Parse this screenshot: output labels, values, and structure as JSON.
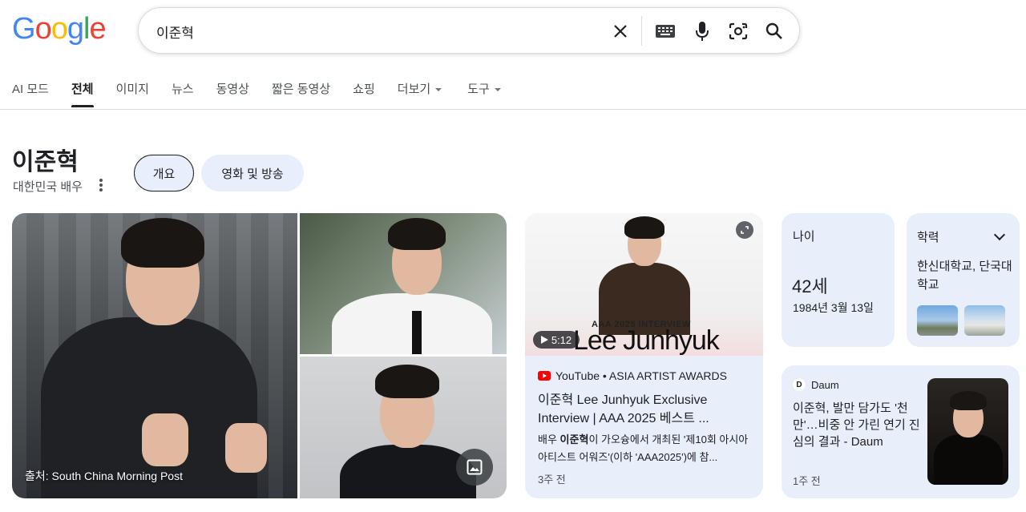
{
  "header": {
    "logo_text": "Google",
    "search": {
      "query": "이준혁"
    }
  },
  "tabs": [
    {
      "label": "AI 모드"
    },
    {
      "label": "전체"
    },
    {
      "label": "이미지"
    },
    {
      "label": "뉴스"
    },
    {
      "label": "동영상"
    },
    {
      "label": "짧은 동영상"
    },
    {
      "label": "쇼핑"
    },
    {
      "label": "더보기"
    },
    {
      "label": "도구"
    }
  ],
  "entity": {
    "title": "이준혁",
    "subtitle": "대한민국 배우",
    "chips": [
      {
        "label": "개요"
      },
      {
        "label": "영화 및 방송"
      }
    ]
  },
  "images": {
    "caption": "출처: South China Morning Post"
  },
  "video": {
    "thumb_tag": "AAA 2025 INTERVIEW",
    "thumb_title": "Lee Junhyuk",
    "duration": "5:12",
    "source": "YouTube • ASIA ARTIST AWARDS",
    "title": "이준혁 Lee Junhyuk Exclusive Interview | AAA 2025 베스트 ...",
    "snippet_pre": "배우 ",
    "snippet_bold": "이준혁",
    "snippet_post": "이 가오슝에서 개최된 '제10회 아시아 아티스트 어워즈'(이하 'AAA2025')에 참...",
    "time": "3주 전"
  },
  "age": {
    "label": "나이",
    "value": "42세",
    "birth": "1984년 3월 13일"
  },
  "education": {
    "label": "학력",
    "value": "한신대학교, 단국대학교"
  },
  "news": {
    "source": "Daum",
    "logo_letter": "D",
    "title": "이준혁, 발만 담가도 '천만'…비중 안 가린 연기 진심의 결과 - Daum",
    "time": "1주 전"
  }
}
